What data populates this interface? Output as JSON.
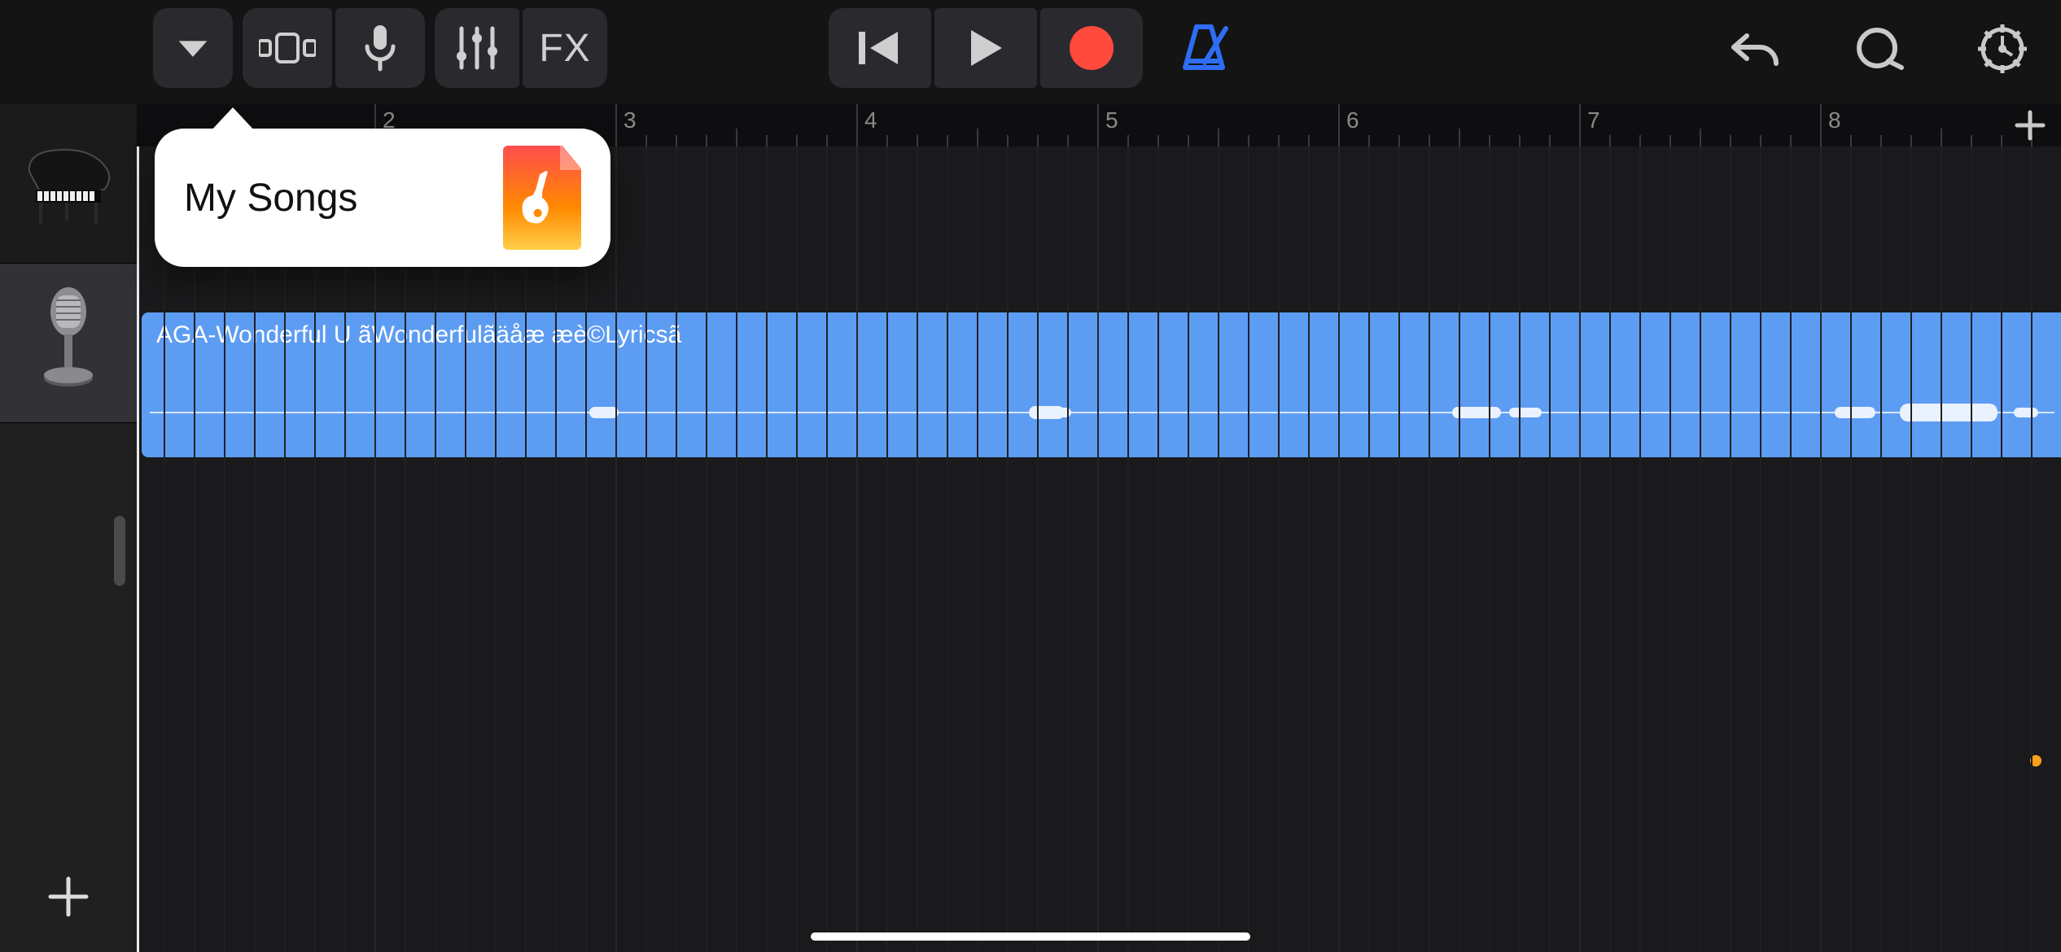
{
  "toolbar": {
    "dropdown": "▼",
    "view_toggle": "track-view-toggle",
    "mic": "microphone",
    "mixer": "mixer",
    "fx_label": "FX",
    "rewind": "rewind",
    "play": "play",
    "record": "record",
    "metronome": "metronome",
    "undo": "undo",
    "loop": "loop",
    "settings": "settings"
  },
  "popover": {
    "title": "My Songs"
  },
  "ruler": {
    "bars": [
      "2",
      "3",
      "4",
      "5",
      "6",
      "7",
      "8"
    ]
  },
  "tracks": {
    "items": [
      {
        "instrument": "grand-piano"
      },
      {
        "instrument": "microphone"
      }
    ]
  },
  "region": {
    "label": "AGA-Wonderful U ãWonderfulãäåæ æè©Lyricsã"
  },
  "colors": {
    "region_blue": "#5d9cf3",
    "record_red": "#ff4a3d",
    "accent_blue": "#2f6df6"
  }
}
